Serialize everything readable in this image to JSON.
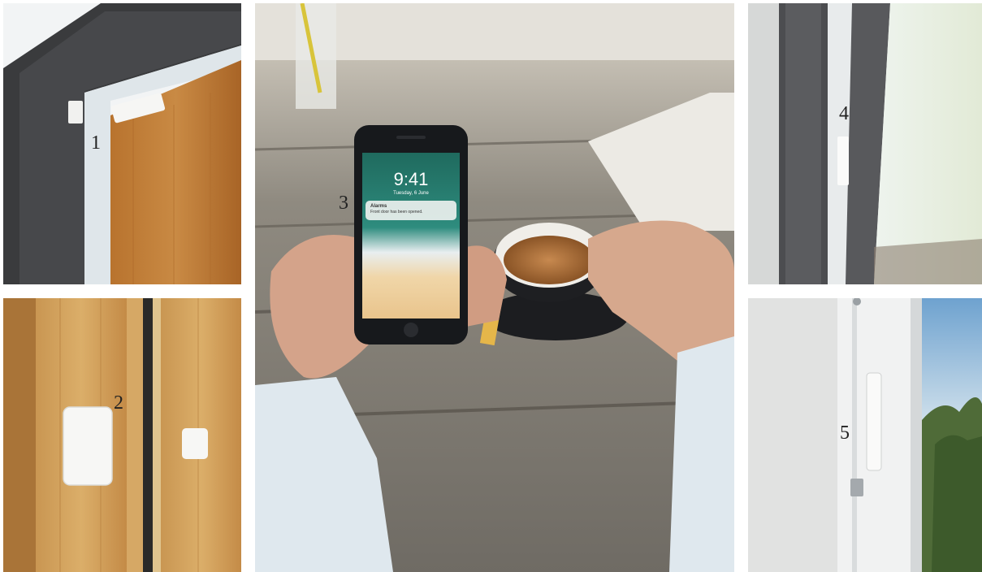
{
  "photos": [
    {
      "id": "door-frame",
      "number": "1"
    },
    {
      "id": "door-edge",
      "number": "2"
    },
    {
      "id": "phone-coffee",
      "number": "3"
    },
    {
      "id": "window-frame",
      "number": "4"
    },
    {
      "id": "window-sash",
      "number": "5"
    }
  ],
  "phone": {
    "time": "9:41",
    "date": "Tuesday, 6 June",
    "notification": {
      "title": "Alarms",
      "body": "Front door has been opened."
    }
  }
}
